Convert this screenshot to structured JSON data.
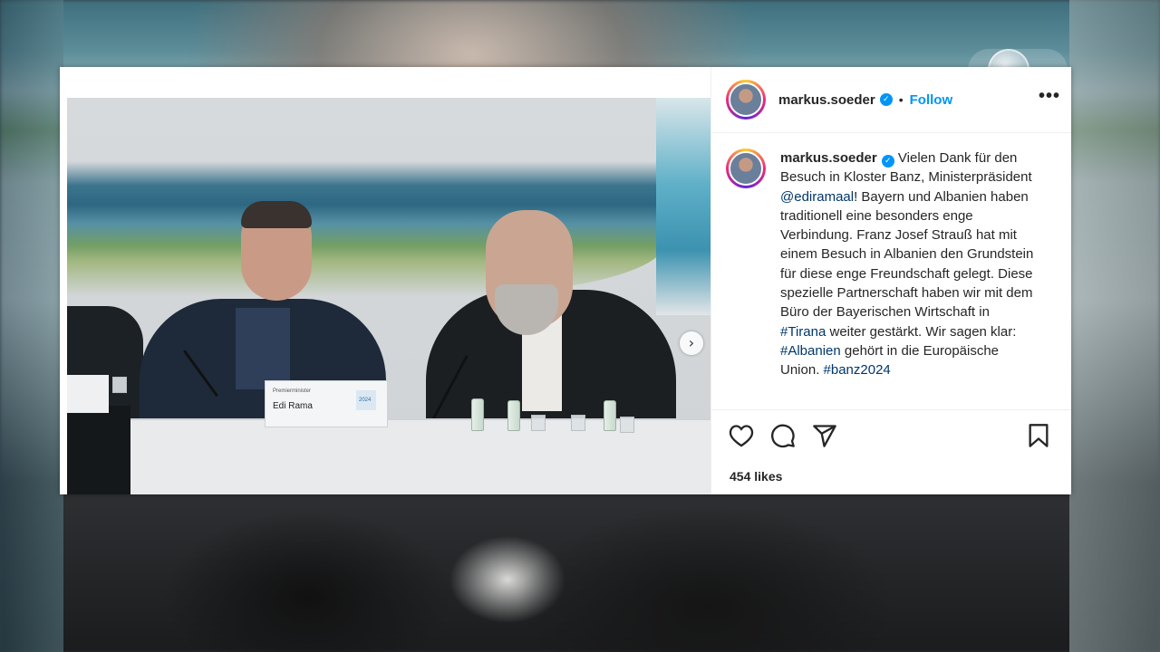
{
  "post": {
    "username": "markus.soeder",
    "follow_label": "Follow",
    "separator": "•",
    "more_label": "•••",
    "caption_parts": [
      {
        "t": "text",
        "v": "Vielen Dank für den Besuch in Kloster Banz, Ministerpräsident "
      },
      {
        "t": "link",
        "v": "@ediramaal"
      },
      {
        "t": "text",
        "v": "! Bayern und Albanien haben traditionell eine besonders enge Verbindung. Franz Josef Strauß hat mit einem Besuch in Albanien den Grundstein für diese enge Freundschaft gelegt. Diese spezielle Partnerschaft haben wir mit dem Büro der Bayerischen Wirtschaft in "
      },
      {
        "t": "link",
        "v": "#Tirana"
      },
      {
        "t": "text",
        "v": " weiter gestärkt. Wir sagen klar: "
      },
      {
        "t": "link",
        "v": "#Albanien"
      },
      {
        "t": "text",
        "v": " gehört in die Europäische Union. "
      },
      {
        "t": "link",
        "v": "#banz2024"
      }
    ],
    "likes": "454 likes",
    "nameplate_small": "Premierminister",
    "nameplate_name": "Edi Rama",
    "nameplate_logo": "2024"
  },
  "icons": {
    "verified": "verified-badge-icon",
    "like": "heart-icon",
    "comment": "comment-icon",
    "share": "send-icon",
    "save": "bookmark-icon",
    "next": "chevron-right-icon"
  },
  "colors": {
    "accent": "#0095f6",
    "link": "#00376b",
    "text": "#262626"
  }
}
